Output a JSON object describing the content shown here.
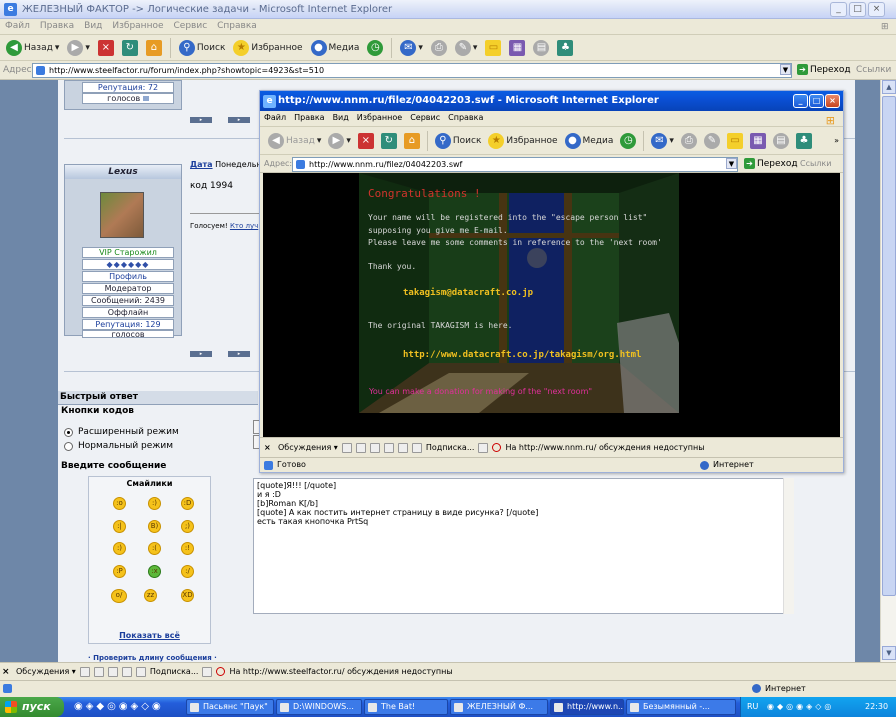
{
  "main_window": {
    "title": "ЖЕЛЕЗНЫЙ ФАКТОР -> Логические задачи - Microsoft Internet Explorer",
    "menu": [
      "Файл",
      "Правка",
      "Вид",
      "Избранное",
      "Сервис",
      "Справка"
    ],
    "toolbar": {
      "back": "Назад",
      "search": "Поиск",
      "favorites": "Избранное",
      "media": "Медиа"
    },
    "address_label": "Адрес:",
    "address": "http://www.steelfactor.ru/forum/index.php?showtopic=4923&st=510",
    "go": "Переход",
    "links": "Ссылки"
  },
  "forum": {
    "top_profile": {
      "reputation": "Репутация: 72",
      "votes": "голосов"
    },
    "post": {
      "username": "Lexus",
      "date_label": "Дата",
      "date_value": "Понедельни",
      "body": "код 1994",
      "voted": "Голосуем!",
      "voted_link": "Кто луч",
      "rank": "VIP Старожил",
      "profile_link": "Профиль",
      "role": "Модератор",
      "messages": "Сообщений: 2439",
      "status": "Оффлайн",
      "reputation": "Репутация: 129",
      "votes": "голосов"
    },
    "quick_reply": "Быстрый ответ",
    "code_buttons": "Кнопки кодов",
    "mode_extended": "Расширенный режим",
    "mode_normal": "Нормальный режим",
    "enter_message": "Введите сообщение",
    "smilies_title": "Смайлики",
    "show_all": "Показать всё",
    "check_length": "· Проверить длину сообщения ·",
    "textarea": "[quote]Я!!! [/quote]\nи я :D\n[b]Roman K[/b]\n[quote] А как постить интернет страницу в виде рисунка? [/quote]\nесть такая кнопочка PrtSq"
  },
  "discussion_bar": {
    "label": "Обсуждения",
    "subscribe": "Подписка...",
    "message": "На http://www.steelfactor.ru/ обсуждения недоступны"
  },
  "status_bar": {
    "zone": "Интернет"
  },
  "popup": {
    "title": "http://www.nnm.ru/filez/04042203.swf - Microsoft Internet Explorer",
    "menu": [
      "Файл",
      "Правка",
      "Вид",
      "Избранное",
      "Сервис",
      "Справка"
    ],
    "toolbar": {
      "back": "Назад",
      "search": "Поиск",
      "favorites": "Избранное",
      "media": "Медиа"
    },
    "address_label": "Адрес:",
    "address": "http://www.nnm.ru/filez/04042203.swf",
    "go": "Переход",
    "links": "Ссылки",
    "flash": {
      "congrats": "Congratulations !",
      "line1": "Your name will be registered into the \"escape person list\"",
      "line2": "supposing you give me E-mail.",
      "line3": "Please leave me some comments in reference to the 'next room'",
      "thanks": "Thank you.",
      "email": "takagism@datacraft.co.jp",
      "original": "The original TAKAGISM is here.",
      "url": "http://www.datacraft.co.jp/takagism/org.html",
      "donation": "You can make a donation for making of the \"next room\""
    },
    "discussion": {
      "label": "Обсуждения",
      "subscribe": "Подписка...",
      "message": "На http://www.nnm.ru/ обсуждения недоступны"
    },
    "status": "Готово",
    "zone": "Интернет"
  },
  "taskbar": {
    "start": "пуск",
    "tasks": [
      "Пасьянс \"Паук\"",
      "D:\\WINDOWS...",
      "The Bat!",
      "ЖЕЛЕЗНЫЙ Ф...",
      "http://www.n...",
      "Безымянный -..."
    ],
    "lang": "RU",
    "clock": "22:30"
  },
  "colors": {
    "accent": "#0a50d5",
    "flash_red": "#d0342c",
    "flash_yellow": "#f0c020",
    "flash_pink": "#e0309a"
  }
}
